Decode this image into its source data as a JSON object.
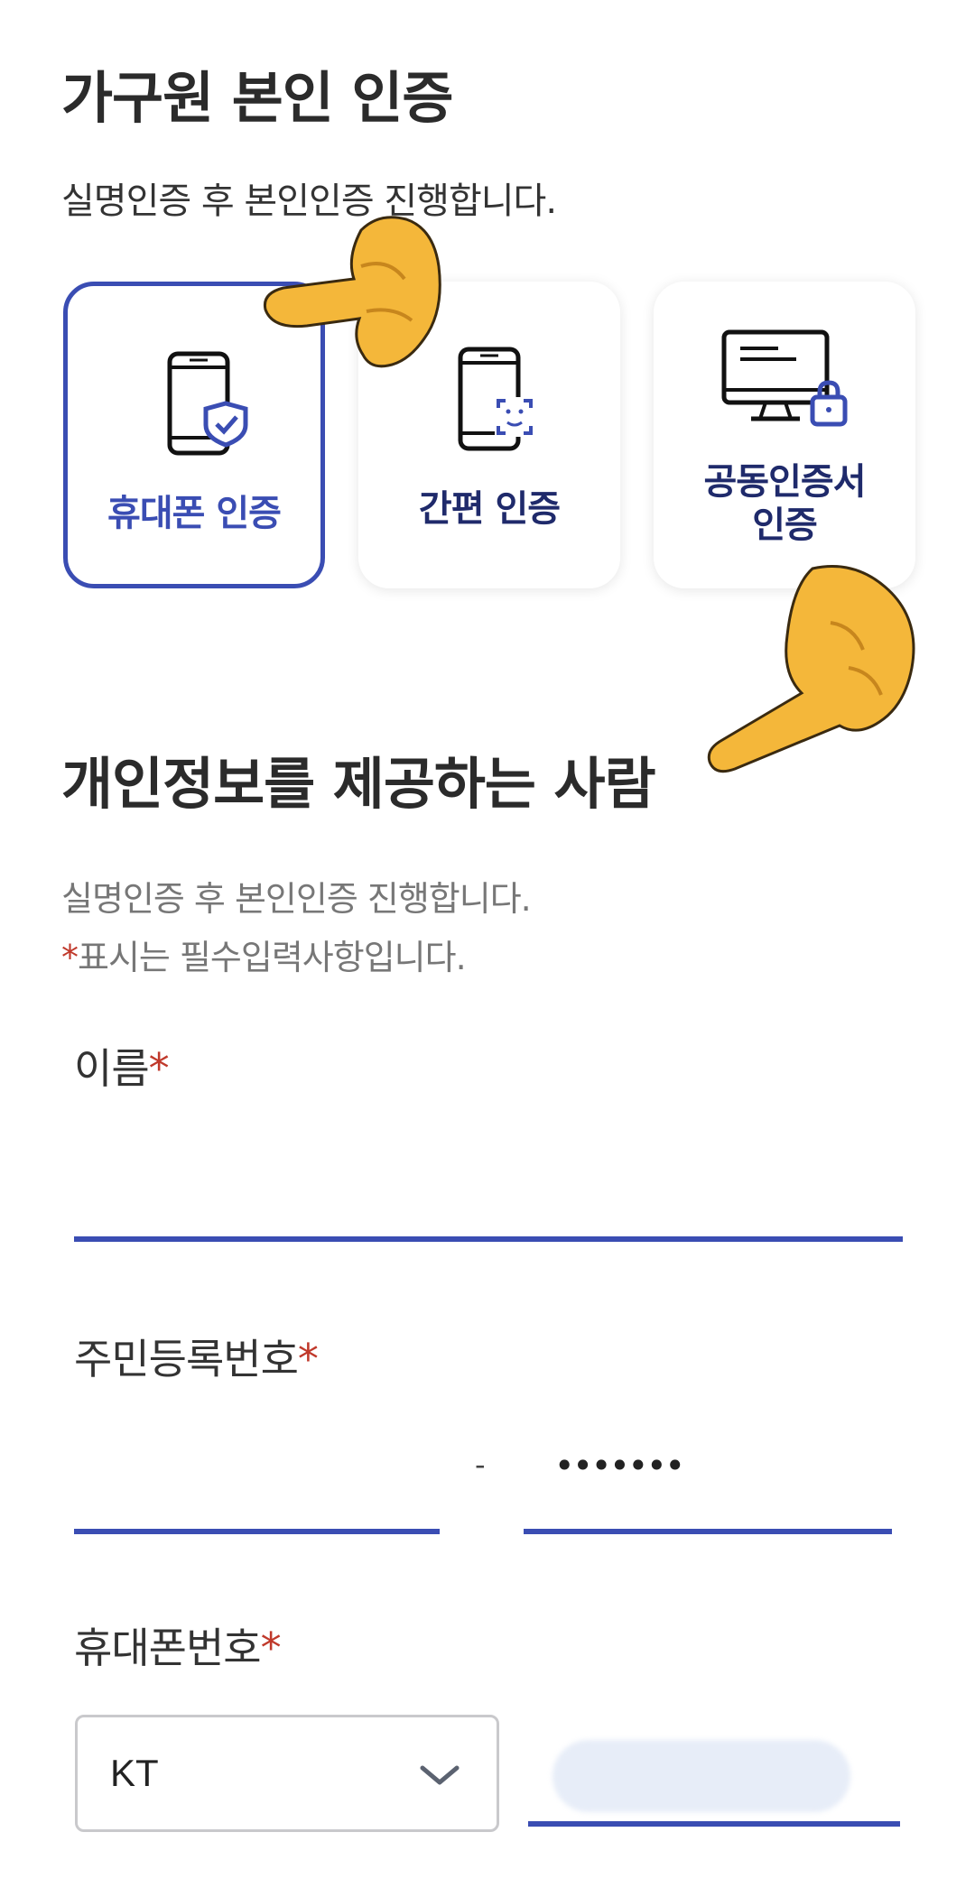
{
  "header": {
    "title": "가구원 본인 인증",
    "subtitle": "실명인증 후 본인인증 진행합니다."
  },
  "auth_methods": [
    {
      "label": "휴대폰 인증",
      "selected": true
    },
    {
      "label": "간편 인증",
      "selected": false
    },
    {
      "label_line1": "공동인증서",
      "label_line2": "인증",
      "selected": false
    }
  ],
  "section": {
    "title": "개인정보를 제공하는 사람",
    "note1": "실명인증 후 본인인증 진행합니다.",
    "note2_star": "*",
    "note2": "표시는 필수입력사항입니다."
  },
  "form": {
    "name_label": "이름",
    "rrn_label": "주민등록번호",
    "rrn_dash": "-",
    "rrn_back_value": "•••••••",
    "phone_label": "휴대폰번호",
    "carrier_value": "KT",
    "required_star": "*"
  },
  "colors": {
    "accent": "#3a4db3",
    "required": "#c0392b"
  }
}
